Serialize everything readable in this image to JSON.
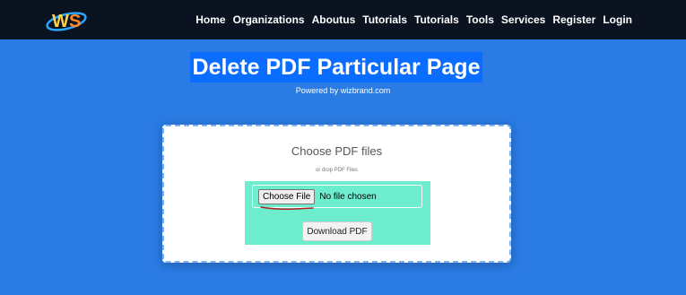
{
  "nav": {
    "logo_text": "WS",
    "links": [
      "Home",
      "Organizations",
      "Aboutus",
      "Tutorials",
      "Tutorials",
      "Tools",
      "Services",
      "Register",
      "Login"
    ]
  },
  "hero": {
    "title": "Delete PDF Particular Page",
    "powered_by": "Powered by wizbrand.com"
  },
  "upload": {
    "heading": "Choose PDF files",
    "drop_note": "or drop PDF Files",
    "file_button_label": "Choose File",
    "file_status": "No file chosen",
    "download_label": "Download PDF"
  },
  "colors": {
    "page_bg": "#2a7be4",
    "navbar_bg": "#0b1220",
    "title_highlight": "#0b6dff",
    "upload_zone": "#6eecce",
    "annotation_mark": "#b02020"
  }
}
